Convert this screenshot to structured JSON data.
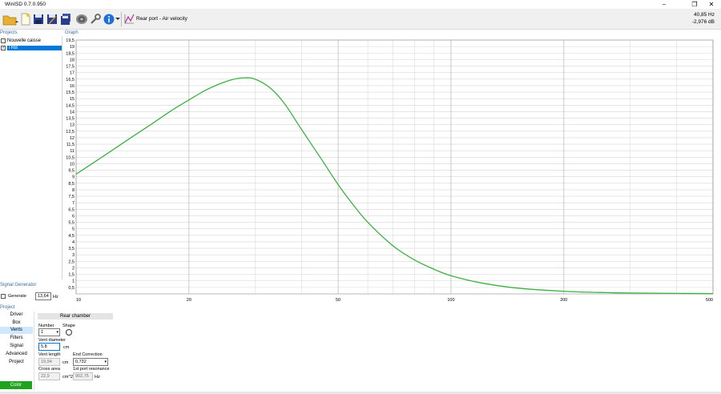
{
  "window": {
    "title": "WinISD 0.7.0.950"
  },
  "toolbar": {
    "graph_selector_label": "Rear port - Air velocity",
    "readout_freq": "40,85 Hz",
    "readout_db": "-2,976 dB",
    "icons": [
      "open-folder-icon",
      "new-document-icon",
      "save-icon",
      "save-as-icon",
      "save-all-icon",
      "driver-icon",
      "wrench-icon",
      "info-icon",
      "graph-select-icon"
    ]
  },
  "projects": {
    "section_label": "Projects",
    "items": [
      {
        "label": "Nouvelle caisse",
        "checked": false,
        "selected": false
      },
      {
        "label": "TRB",
        "checked": true,
        "selected": true
      }
    ]
  },
  "graph": {
    "section_label": "Graph"
  },
  "signal_generator": {
    "section_label": "Signal Generator",
    "generate_label": "Generate",
    "frequency_value": "13,64",
    "frequency_unit": "Hz"
  },
  "project_section": {
    "section_label": "Project",
    "nav": [
      "Driver",
      "Box",
      "Vents",
      "Filters",
      "Signal",
      "Advanced",
      "Project"
    ],
    "selected_nav": "Vents",
    "color_button": "Color",
    "color_button_color": "#1fa31f"
  },
  "vents": {
    "tab_label": "Rear chamber",
    "number_label": "Number",
    "number_value": "1",
    "shape_label": "Shape",
    "diameter_label": "Vent diameter",
    "diameter_value": "5,8",
    "diameter_unit": "cm",
    "length_label": "Vent length",
    "length_value": "19,94",
    "length_unit": "cm",
    "end_correction_label": "End Correction",
    "end_correction_value": "0,732",
    "cross_area_label": "Cross area",
    "cross_area_value": "22,9",
    "cross_area_unit": "cm^2",
    "resonance_label": "1st port resonance",
    "resonance_value": "902,75",
    "resonance_unit": "Hz"
  },
  "chart_data": {
    "type": "line",
    "title": "",
    "xlabel": "",
    "ylabel": "",
    "x_scale": "log",
    "xlim": [
      10,
      500
    ],
    "ylim": [
      0,
      19.5
    ],
    "x_ticks": [
      10,
      20,
      50,
      100,
      200,
      500
    ],
    "y_ticks": [
      "0,5",
      "1",
      "1,5",
      "2",
      "2,5",
      "3",
      "3,5",
      "4",
      "4,5",
      "5",
      "5,5",
      "6",
      "6,5",
      "7",
      "7,5",
      "8",
      "8,5",
      "9",
      "9,5",
      "10",
      "10,5",
      "11",
      "11,5",
      "12",
      "12,5",
      "13",
      "13,5",
      "14",
      "14,5",
      "15",
      "15,5",
      "16",
      "16,5",
      "17",
      "17,5",
      "18",
      "18,5",
      "19",
      "19,5"
    ],
    "grid": true,
    "line_color": "#3cb043",
    "series": [
      {
        "x": [
          10,
          12,
          14,
          16,
          18,
          20,
          22,
          24,
          26,
          28,
          30,
          33,
          36,
          40,
          45,
          50,
          55,
          60,
          70,
          80,
          90,
          100,
          120,
          150,
          200,
          250,
          300,
          400,
          500
        ],
        "y": [
          9.2,
          10.7,
          12.0,
          13.1,
          14.1,
          14.9,
          15.6,
          16.1,
          16.45,
          16.6,
          16.5,
          15.8,
          14.6,
          12.6,
          10.4,
          8.4,
          6.8,
          5.5,
          3.7,
          2.6,
          1.9,
          1.4,
          0.85,
          0.45,
          0.2,
          0.11,
          0.07,
          0.04,
          0.02
        ]
      }
    ]
  }
}
